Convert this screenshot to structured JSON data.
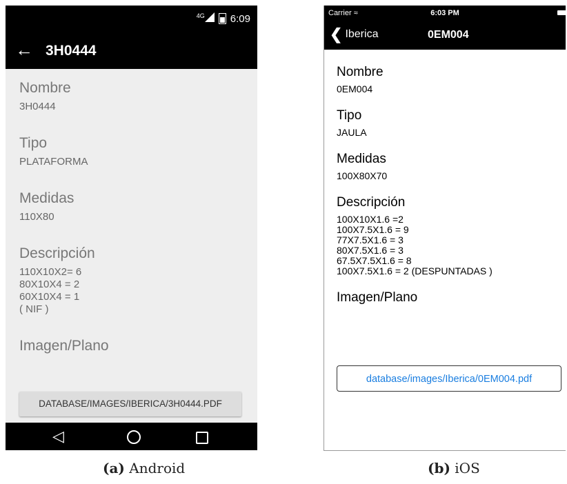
{
  "android": {
    "status": {
      "network": "4G",
      "time": "6:09"
    },
    "appbar": {
      "title": "3H0444"
    },
    "fields": [
      {
        "label": "Nombre",
        "value": "3H0444"
      },
      {
        "label": "Tipo",
        "value": "PLATAFORMA"
      },
      {
        "label": "Medidas",
        "value": "110X80"
      },
      {
        "label": "Descripción",
        "value": "110X10X2= 6\n80X10X4 = 2\n60X10X4 = 1\n( NIF )"
      },
      {
        "label": "Imagen/Plano",
        "value": ""
      }
    ],
    "pdf_button": "DATABASE/IMAGES/IBERICA/3H0444.PDF"
  },
  "ios": {
    "status": {
      "carrier": "Carrier",
      "time": "6:03 PM"
    },
    "navbar": {
      "back_label": "Iberica",
      "title": "0EM004"
    },
    "fields": [
      {
        "label": "Nombre",
        "value": "0EM004"
      },
      {
        "label": "Tipo",
        "value": "JAULA"
      },
      {
        "label": "Medidas",
        "value": "100X80X70"
      },
      {
        "label": "Descripción",
        "value": "100X10X1.6 =2\n100X7.5X1.6 = 9\n77X7.5X1.6 = 3\n80X7.5X1.6 = 3\n67.5X7.5X1.6 = 8\n100X7.5X1.6 = 2 (DESPUNTADAS )"
      },
      {
        "label": "Imagen/Plano",
        "value": ""
      }
    ],
    "pdf_button": "database/images/Iberica/0EM004.pdf"
  },
  "captions": {
    "a_tag": "(a)",
    "a_text": "Android",
    "b_tag": "(b)",
    "b_text": "iOS"
  }
}
